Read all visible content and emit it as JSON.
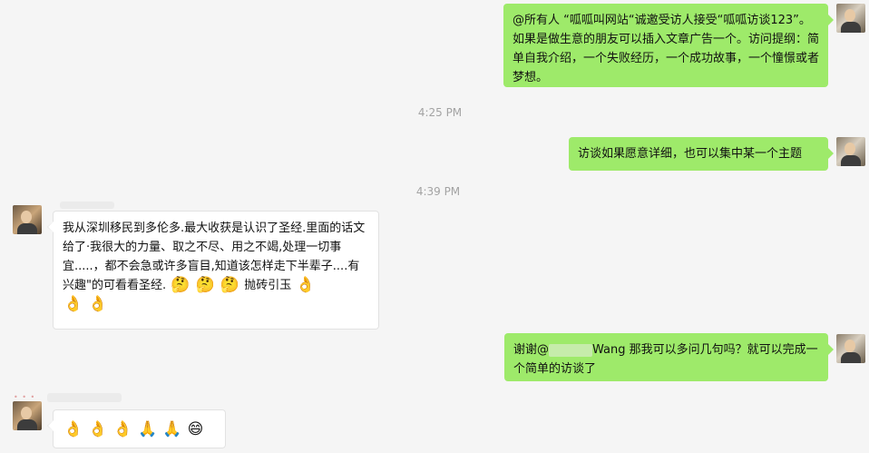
{
  "messages": [
    {
      "side": "right",
      "text": "@所有人 “呱呱叫网站“诚邀受访人接受“呱呱访谈123”。如果是做生意的朋友可以插入文章广告一个。访问提纲：简单自我介绍，一个失败经历，一个成功故事，一个憧憬或者梦想。"
    },
    {
      "timestamp": "4:25 PM"
    },
    {
      "side": "right",
      "text": "访谈如果愿意详细，也可以集中某一个主题"
    },
    {
      "timestamp": "4:39 PM"
    },
    {
      "side": "left",
      "text": "我从深圳移民到多伦多.最大收获是认识了圣经.里面的话文给了·我很大的力量、取之不尽、用之不竭,处理一切事宜.....，都不会急或许多盲目,知道该怎样走下半辈子....有兴趣\"的可看看圣经.",
      "emojis_inline": [
        "🤔",
        "🤔",
        "🤔"
      ],
      "tail_text": "抛砖引玉",
      "emojis_after": [
        "👌",
        "👌",
        "👌"
      ]
    },
    {
      "side": "right",
      "text_before": "谢谢@",
      "text_after": "Wang 那我可以多问几句吗？就可以完成一个简单的访谈了"
    },
    {
      "side": "left",
      "emojis": [
        "👌",
        "👌",
        "👌",
        "🙏",
        "🙏",
        "😄"
      ]
    }
  ]
}
